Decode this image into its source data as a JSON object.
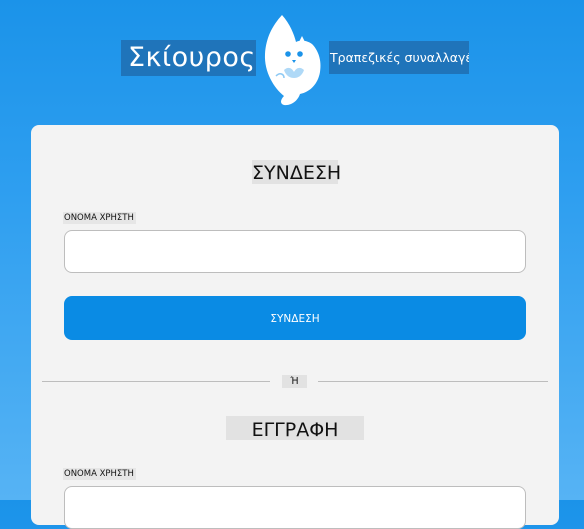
{
  "header": {
    "brand_name": "Σκίουρος",
    "tagline": "Τραπεζικές συναλλαγές",
    "logo_icon": "squirrel-logo-icon"
  },
  "login": {
    "title": "ΣΥΝΔΕΣΗ",
    "username_label": "ΟΝΟΜΑ ΧΡΗΣΤΗ",
    "username_value": "",
    "submit_label": "ΣΥΝΔΕΣΗ"
  },
  "divider": {
    "text": "Ή"
  },
  "register": {
    "title": "ΕΓΓΡΑΦΗ",
    "username_label": "ΟΝΟΜΑ ΧΡΗΣΤΗ",
    "username_value": ""
  },
  "colors": {
    "background_top": "#1b93e9",
    "accent": "#0a8be4",
    "card": "#f3f3f3"
  }
}
